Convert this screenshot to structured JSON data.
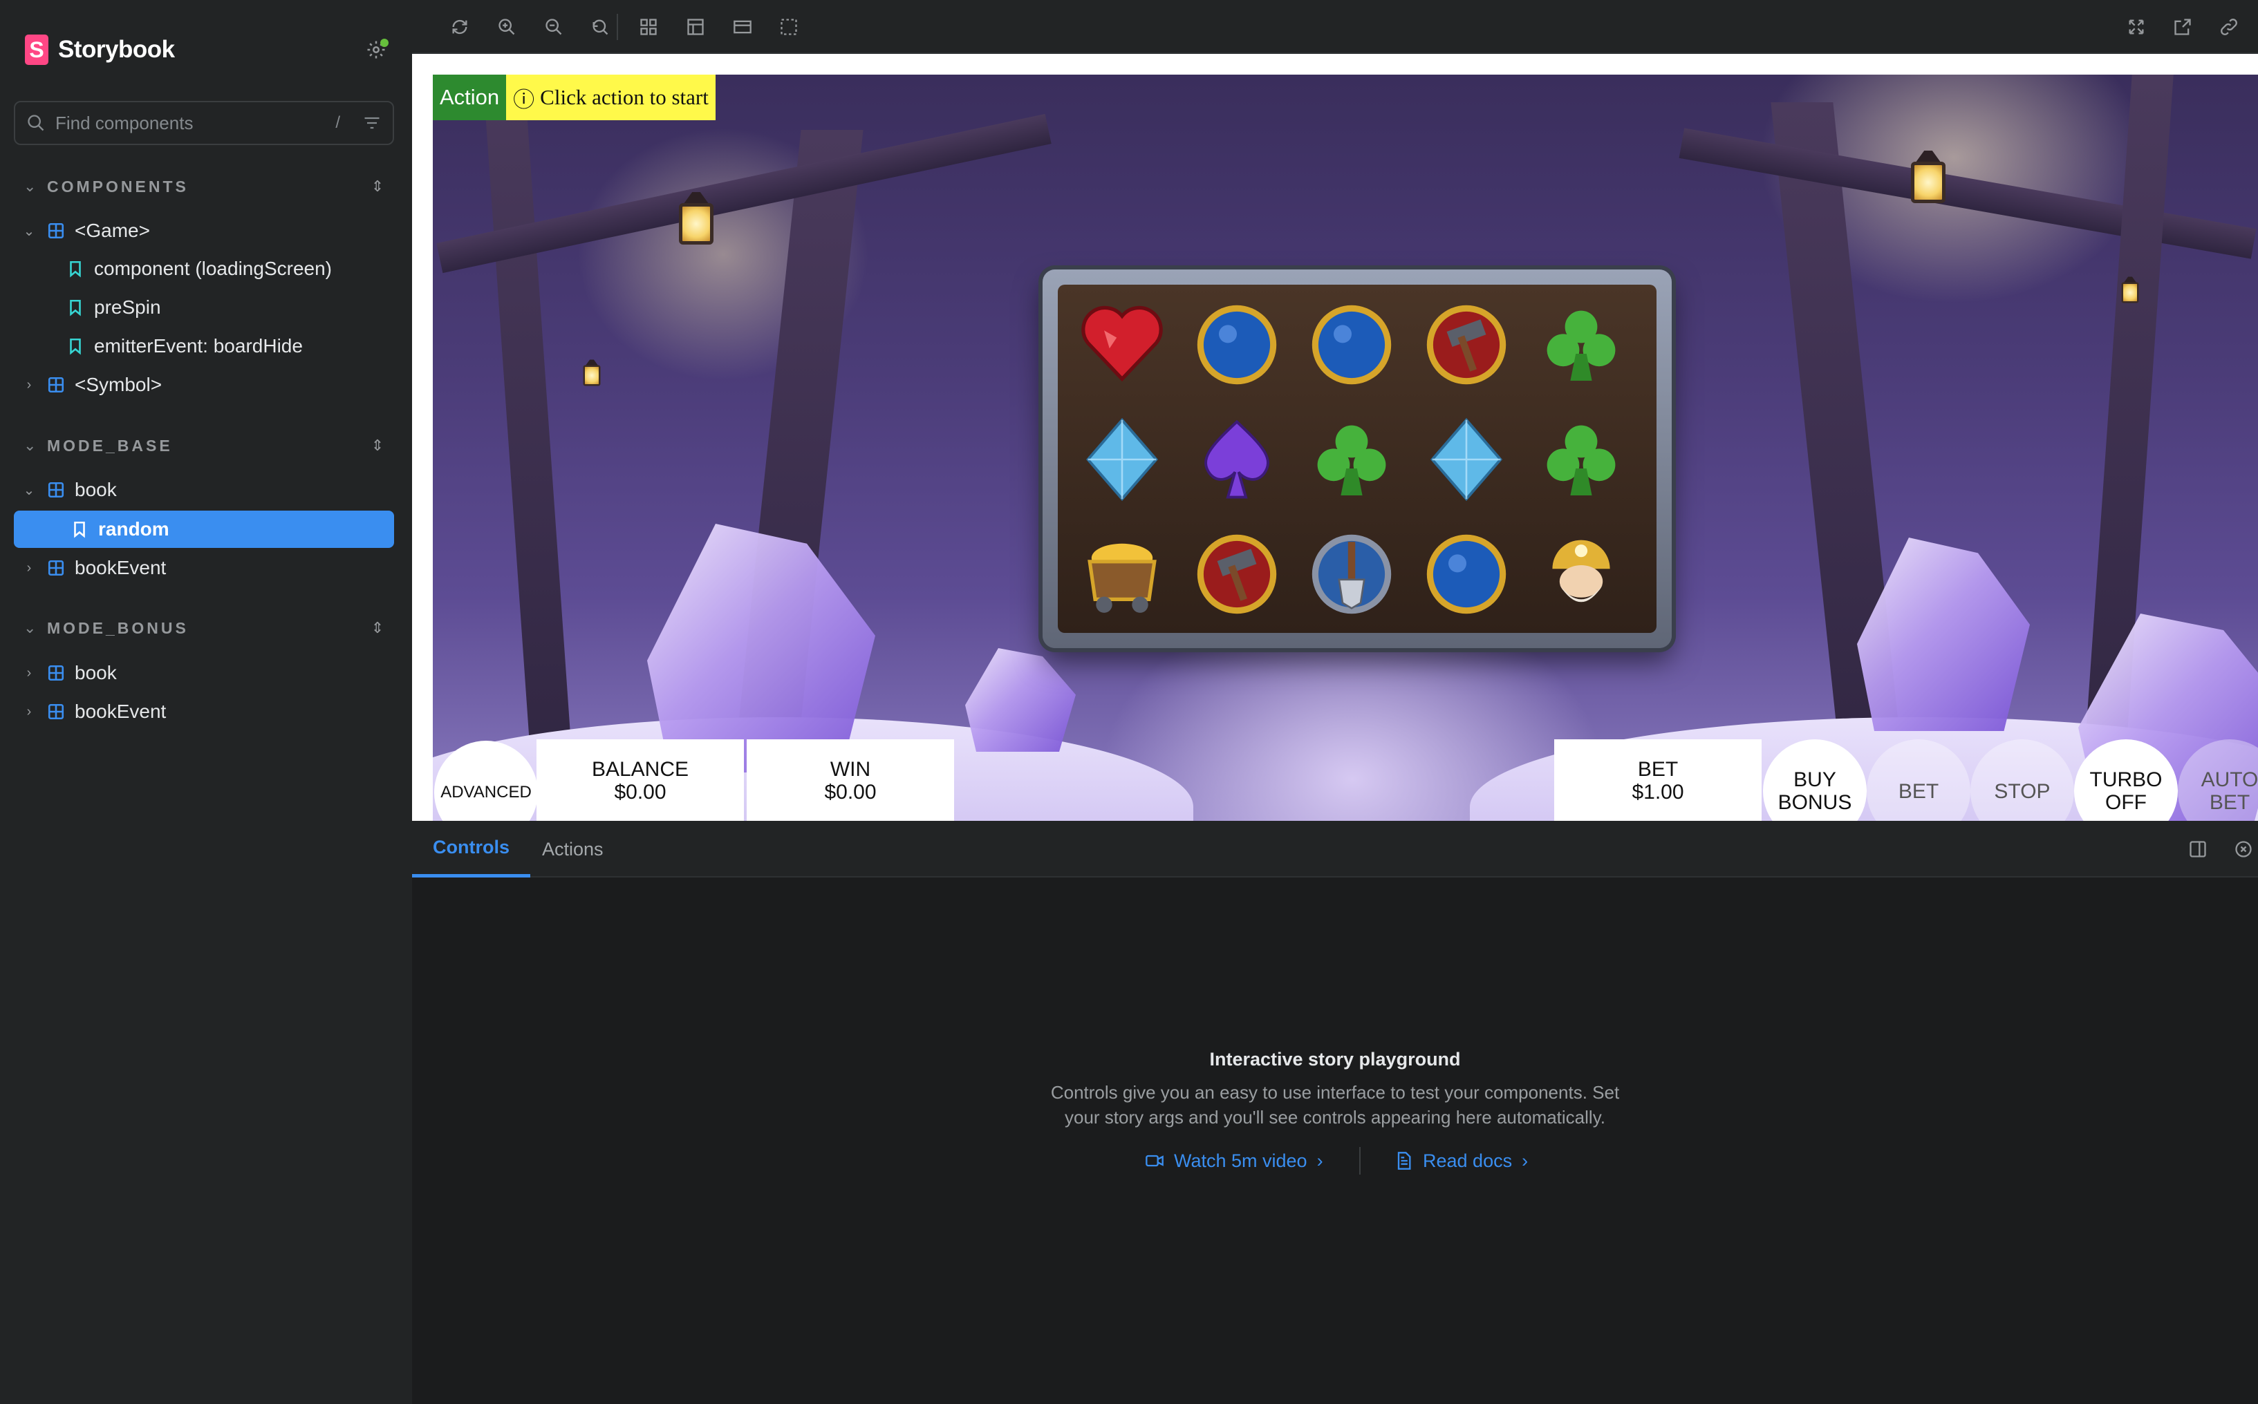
{
  "sidebar": {
    "brand": "Storybook",
    "search_placeholder": "Find components",
    "search_shortcut": "/",
    "sections": [
      {
        "title": "COMPONENTS",
        "items": [
          {
            "label": "<Game>",
            "type": "component",
            "expanded": true
          },
          {
            "label": "component (loadingScreen)",
            "type": "story"
          },
          {
            "label": "preSpin",
            "type": "story"
          },
          {
            "label": "emitterEvent: boardHide",
            "type": "story"
          },
          {
            "label": "<Symbol>",
            "type": "component",
            "expanded": false
          }
        ]
      },
      {
        "title": "MODE_BASE",
        "items": [
          {
            "label": "book",
            "type": "component",
            "expanded": true
          },
          {
            "label": "random",
            "type": "story",
            "selected": true
          },
          {
            "label": "bookEvent",
            "type": "component",
            "expanded": false
          }
        ]
      },
      {
        "title": "MODE_BONUS",
        "items": [
          {
            "label": "book",
            "type": "component",
            "expanded": false
          },
          {
            "label": "bookEvent",
            "type": "component",
            "expanded": false
          }
        ]
      }
    ]
  },
  "toolbar": {
    "left_icons": [
      "reload-icon",
      "zoom-in-icon",
      "zoom-out-icon",
      "zoom-reset-icon",
      "grid-icon",
      "background-icon",
      "viewport-icon",
      "outline-icon"
    ],
    "right_icons": [
      "fullscreen-icon",
      "open-new-tab-icon",
      "copy-link-icon"
    ]
  },
  "canvas": {
    "action_label": "Action",
    "action_message": "Click action to start",
    "symbols": [
      [
        "heart",
        "blue-orb",
        "blue-orb",
        "hammer",
        "club"
      ],
      [
        "diamond",
        "spade",
        "club",
        "diamond",
        "club"
      ],
      [
        "treasure-cart",
        "hammer",
        "shovel",
        "blue-orb",
        "miner"
      ]
    ],
    "hud": {
      "advanced": "ADVANCED",
      "balance_label": "BALANCE",
      "balance_value": "$0.00",
      "win_label": "WIN",
      "win_value": "$0.00",
      "bet_label": "BET",
      "bet_value": "$1.00",
      "buy_bonus_1": "BUY",
      "buy_bonus_2": "BONUS",
      "bet_button": "BET",
      "stop_button": "STOP",
      "turbo_1": "TURBO",
      "turbo_2": "OFF",
      "auto_1": "AUTO",
      "auto_2": "BET"
    }
  },
  "panel": {
    "tabs": [
      "Controls",
      "Actions"
    ],
    "active_tab": "Controls",
    "empty_title": "Interactive story playground",
    "empty_line1": "Controls give you an easy to use interface to test your components. Set",
    "empty_line2": "your story args and you'll see controls appearing here automatically.",
    "link_video": "Watch 5m video",
    "link_docs": "Read docs"
  },
  "colors": {
    "accent": "#3a8ef0",
    "brand": "#ff4785",
    "status_dot": "#66bf3c",
    "action_green": "#2d8a2f",
    "action_yellow": "#fff94a"
  }
}
